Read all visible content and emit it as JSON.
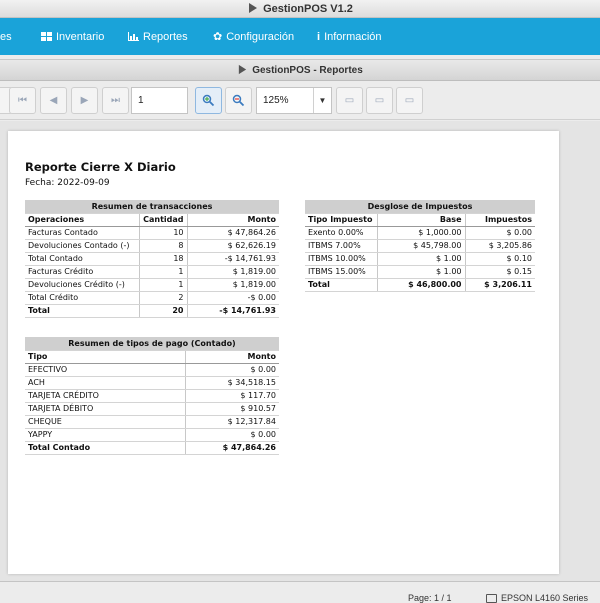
{
  "window": {
    "title": "GestionPOS V1.2"
  },
  "menu": [
    {
      "label": "es",
      "icon": "none"
    },
    {
      "label": "Inventario",
      "icon": "grid-icon"
    },
    {
      "label": "Reportes",
      "icon": "bar-chart-icon"
    },
    {
      "label": "Configuración",
      "icon": "gear-icon"
    },
    {
      "label": "Información",
      "icon": "info-icon"
    }
  ],
  "report_window": {
    "title": "GestionPOS - Reportes"
  },
  "toolbar": {
    "page_value": "1",
    "zoom_value": "125%"
  },
  "report": {
    "title": "Reporte Cierre X Diario",
    "date": "Fecha: 2022-09-09",
    "transactions": {
      "caption": "Resumen de transacciones",
      "headers": [
        "Operaciones",
        "Cantidad",
        "Monto"
      ],
      "rows": [
        [
          "Facturas Contado",
          "10",
          "$ 47,864.26"
        ],
        [
          "Devoluciones Contado (-)",
          "8",
          "$ 62,626.19"
        ],
        [
          "Total Contado",
          "18",
          "-$ 14,761.93"
        ],
        [
          "Facturas Crédito",
          "1",
          "$ 1,819.00"
        ],
        [
          "Devoluciones Crédito (-)",
          "1",
          "$ 1,819.00"
        ],
        [
          "Total Crédito",
          "2",
          "-$ 0.00"
        ],
        [
          "Total",
          "20",
          "-$ 14,761.93"
        ]
      ]
    },
    "payments": {
      "caption": "Resumen de tipos de pago (Contado)",
      "headers": [
        "Tipo",
        "Monto"
      ],
      "rows": [
        [
          "EFECTIVO",
          "$ 0.00"
        ],
        [
          "ACH",
          "$ 34,518.15"
        ],
        [
          "TARJETA CRÉDITO",
          "$ 117.70"
        ],
        [
          "TARJETA DÉBITO",
          "$ 910.57"
        ],
        [
          "CHEQUE",
          "$ 12,317.84"
        ],
        [
          "YAPPY",
          "$ 0.00"
        ],
        [
          "Total Contado",
          "$ 47,864.26"
        ]
      ]
    },
    "taxes": {
      "caption": "Desglose de Impuestos",
      "headers": [
        "Tipo Impuesto",
        "Base",
        "Impuestos"
      ],
      "rows": [
        [
          "Exento 0.00%",
          "$ 1,000.00",
          "$ 0.00"
        ],
        [
          "ITBMS 7.00%",
          "$ 45,798.00",
          "$ 3,205.86"
        ],
        [
          "ITBMS 10.00%",
          "$ 1.00",
          "$ 0.10"
        ],
        [
          "ITBMS 15.00%",
          "$ 1.00",
          "$ 0.15"
        ],
        [
          "Total",
          "$ 46,800.00",
          "$ 3,206.11"
        ]
      ]
    }
  },
  "status": {
    "page_info": "Page: 1 / 1",
    "printer": "EPSON L4160 Series"
  },
  "colors": {
    "menubar": "#1aa3d9"
  }
}
